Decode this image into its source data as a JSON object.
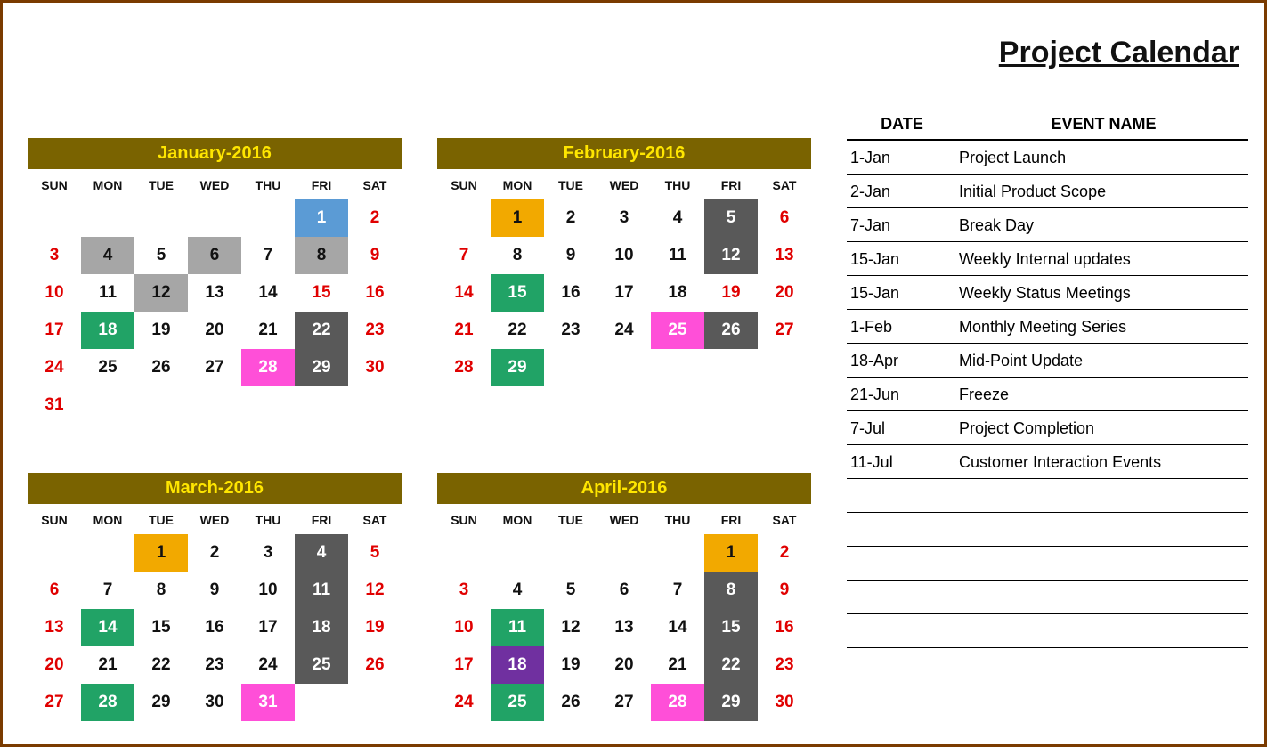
{
  "title": "Project Calendar",
  "dow": [
    "SUN",
    "MON",
    "TUE",
    "WED",
    "THU",
    "FRI",
    "SAT"
  ],
  "months": [
    {
      "title": "January-2016",
      "startDow": 5,
      "cells": [
        {
          "n": 1,
          "cls": "hl-blue"
        },
        {
          "n": 2,
          "cls": "sat"
        },
        {
          "n": 3,
          "cls": "sun"
        },
        {
          "n": 4,
          "cls": "hl-grey"
        },
        {
          "n": 5
        },
        {
          "n": 6,
          "cls": "hl-grey"
        },
        {
          "n": 7
        },
        {
          "n": 8,
          "cls": "hl-grey"
        },
        {
          "n": 9,
          "cls": "sat"
        },
        {
          "n": 10,
          "cls": "sun"
        },
        {
          "n": 11
        },
        {
          "n": 12,
          "cls": "hl-grey"
        },
        {
          "n": 13
        },
        {
          "n": 14
        },
        {
          "n": 15,
          "cls": "fri-red"
        },
        {
          "n": 16,
          "cls": "sat"
        },
        {
          "n": 17,
          "cls": "sun"
        },
        {
          "n": 18,
          "cls": "hl-green"
        },
        {
          "n": 19
        },
        {
          "n": 20
        },
        {
          "n": 21
        },
        {
          "n": 22,
          "cls": "hl-dark"
        },
        {
          "n": 23,
          "cls": "sat"
        },
        {
          "n": 24,
          "cls": "sun"
        },
        {
          "n": 25
        },
        {
          "n": 26
        },
        {
          "n": 27
        },
        {
          "n": 28,
          "cls": "hl-pink"
        },
        {
          "n": 29,
          "cls": "hl-dark"
        },
        {
          "n": 30,
          "cls": "sat"
        },
        {
          "n": 31,
          "cls": "sun"
        }
      ]
    },
    {
      "title": "February-2016",
      "startDow": 1,
      "cells": [
        {
          "n": 1,
          "cls": "hl-orange"
        },
        {
          "n": 2
        },
        {
          "n": 3
        },
        {
          "n": 4
        },
        {
          "n": 5,
          "cls": "hl-dark"
        },
        {
          "n": 6,
          "cls": "sat"
        },
        {
          "n": 7,
          "cls": "sun"
        },
        {
          "n": 8
        },
        {
          "n": 9
        },
        {
          "n": 10
        },
        {
          "n": 11
        },
        {
          "n": 12,
          "cls": "hl-dark"
        },
        {
          "n": 13,
          "cls": "sat"
        },
        {
          "n": 14,
          "cls": "sun"
        },
        {
          "n": 15,
          "cls": "hl-green"
        },
        {
          "n": 16
        },
        {
          "n": 17
        },
        {
          "n": 18
        },
        {
          "n": 19,
          "cls": "fri-red"
        },
        {
          "n": 20,
          "cls": "sat"
        },
        {
          "n": 21,
          "cls": "sun"
        },
        {
          "n": 22
        },
        {
          "n": 23
        },
        {
          "n": 24
        },
        {
          "n": 25,
          "cls": "hl-pink"
        },
        {
          "n": 26,
          "cls": "hl-dark"
        },
        {
          "n": 27,
          "cls": "sat"
        },
        {
          "n": 28,
          "cls": "sun"
        },
        {
          "n": 29,
          "cls": "hl-green"
        }
      ]
    },
    {
      "title": "March-2016",
      "startDow": 2,
      "cells": [
        {
          "n": 1,
          "cls": "hl-orange"
        },
        {
          "n": 2
        },
        {
          "n": 3
        },
        {
          "n": 4,
          "cls": "hl-dark"
        },
        {
          "n": 5,
          "cls": "sat"
        },
        {
          "n": 6,
          "cls": "sun"
        },
        {
          "n": 7
        },
        {
          "n": 8
        },
        {
          "n": 9
        },
        {
          "n": 10
        },
        {
          "n": 11,
          "cls": "hl-dark"
        },
        {
          "n": 12,
          "cls": "sat"
        },
        {
          "n": 13,
          "cls": "sun"
        },
        {
          "n": 14,
          "cls": "hl-green"
        },
        {
          "n": 15
        },
        {
          "n": 16
        },
        {
          "n": 17
        },
        {
          "n": 18,
          "cls": "hl-dark"
        },
        {
          "n": 19,
          "cls": "sat"
        },
        {
          "n": 20,
          "cls": "sun"
        },
        {
          "n": 21
        },
        {
          "n": 22
        },
        {
          "n": 23
        },
        {
          "n": 24
        },
        {
          "n": 25,
          "cls": "hl-dark"
        },
        {
          "n": 26,
          "cls": "sat"
        },
        {
          "n": 27,
          "cls": "sun"
        },
        {
          "n": 28,
          "cls": "hl-green"
        },
        {
          "n": 29
        },
        {
          "n": 30
        },
        {
          "n": 31,
          "cls": "hl-pink"
        }
      ]
    },
    {
      "title": "April-2016",
      "startDow": 5,
      "cells": [
        {
          "n": 1,
          "cls": "hl-orange"
        },
        {
          "n": 2,
          "cls": "sat"
        },
        {
          "n": 3,
          "cls": "sun"
        },
        {
          "n": 4
        },
        {
          "n": 5
        },
        {
          "n": 6
        },
        {
          "n": 7
        },
        {
          "n": 8,
          "cls": "hl-dark"
        },
        {
          "n": 9,
          "cls": "sat"
        },
        {
          "n": 10,
          "cls": "sun"
        },
        {
          "n": 11,
          "cls": "hl-green"
        },
        {
          "n": 12
        },
        {
          "n": 13
        },
        {
          "n": 14
        },
        {
          "n": 15,
          "cls": "hl-dark"
        },
        {
          "n": 16,
          "cls": "sat"
        },
        {
          "n": 17,
          "cls": "sun"
        },
        {
          "n": 18,
          "cls": "hl-purple"
        },
        {
          "n": 19
        },
        {
          "n": 20
        },
        {
          "n": 21
        },
        {
          "n": 22,
          "cls": "hl-dark"
        },
        {
          "n": 23,
          "cls": "sat"
        },
        {
          "n": 24,
          "cls": "sun"
        },
        {
          "n": 25,
          "cls": "hl-green"
        },
        {
          "n": 26
        },
        {
          "n": 27
        },
        {
          "n": 28,
          "cls": "hl-pink"
        },
        {
          "n": 29,
          "cls": "hl-dark"
        },
        {
          "n": 30,
          "cls": "sat"
        }
      ]
    }
  ],
  "events_header": {
    "date": "DATE",
    "event": "EVENT NAME"
  },
  "events": [
    {
      "date": "1-Jan",
      "name": "Project Launch"
    },
    {
      "date": "2-Jan",
      "name": "Initial Product Scope"
    },
    {
      "date": "7-Jan",
      "name": "Break Day"
    },
    {
      "date": "15-Jan",
      "name": "Weekly Internal updates"
    },
    {
      "date": "15-Jan",
      "name": "Weekly Status Meetings"
    },
    {
      "date": "1-Feb",
      "name": "Monthly Meeting Series"
    },
    {
      "date": "18-Apr",
      "name": "Mid-Point Update"
    },
    {
      "date": "21-Jun",
      "name": "Freeze"
    },
    {
      "date": "7-Jul",
      "name": "Project Completion"
    },
    {
      "date": "11-Jul",
      "name": "Customer Interaction Events"
    }
  ],
  "blank_event_rows": 5
}
